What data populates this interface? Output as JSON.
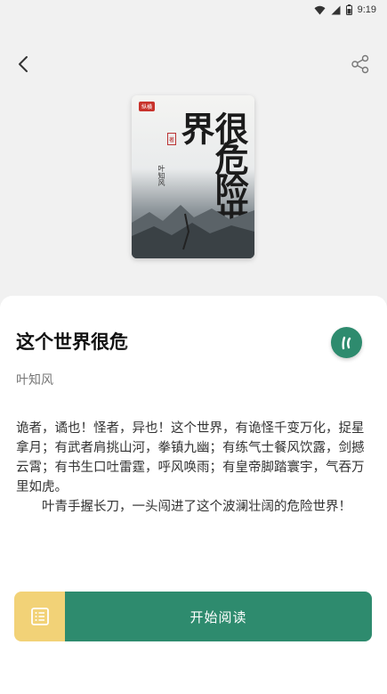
{
  "status_bar": {
    "time": "9:19",
    "icons": [
      "wifi-icon",
      "signal-icon",
      "battery-icon"
    ]
  },
  "nav": {
    "back_icon": "back-arrow-icon",
    "share_icon": "share-icon"
  },
  "cover": {
    "publisher": "纵横",
    "title": "很危险世界",
    "author": "叶知风",
    "seal": "著"
  },
  "book": {
    "title": "这个世界很危",
    "author": "叶知风",
    "summary_p1": "诡者，谲也！怪者，异也！这个世界，有诡怪千变万化，捉星拿月；有武者肩挑山河，拳镇九幽；有练气士餐风饮露，剑撼云霄；有书生口吐雷霆，呼风唤雨；有皇帝脚踏寰宇，气吞万里如虎。",
    "summary_p2": "叶青手握长刀，一头闯进了这个波澜壮阔的危险世界！"
  },
  "actions": {
    "read_label": "开始阅读",
    "shelf_icon": "bookshelf-icon"
  },
  "colors": {
    "accent": "#2e8b6e",
    "shelf": "#f2d277"
  }
}
